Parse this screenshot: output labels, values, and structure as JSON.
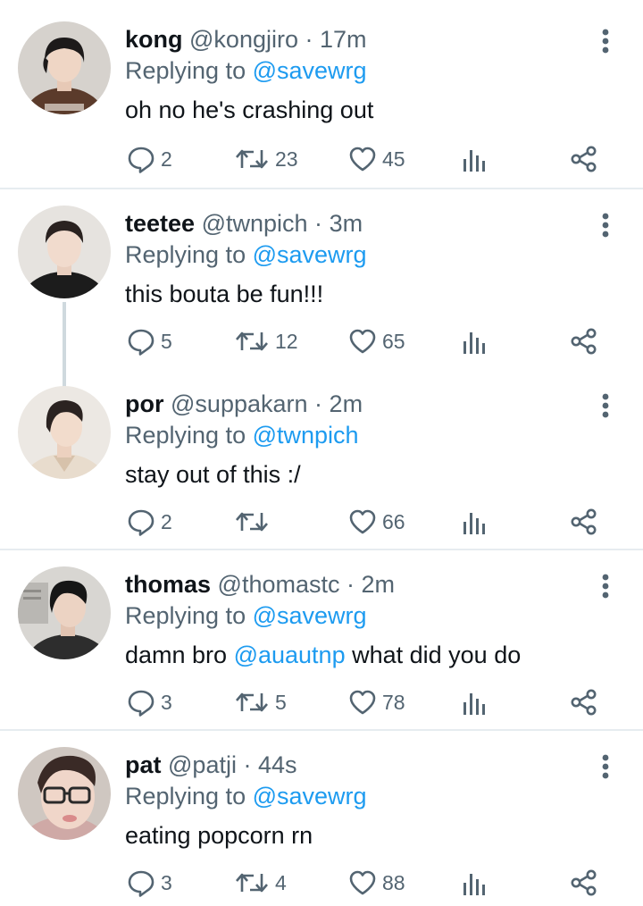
{
  "tweets": [
    {
      "name": "kong",
      "handle": "@kongjiro",
      "sep": "·",
      "time": "17m",
      "replying_prefix": "Replying to",
      "replying_to": "@savewrg",
      "text_before": "oh no he's crashing out",
      "mention": "",
      "text_after": "",
      "replies": "2",
      "retweets": "23",
      "likes": "45"
    },
    {
      "name": "teetee",
      "handle": "@twnpich",
      "sep": "·",
      "time": "3m",
      "replying_prefix": "Replying to",
      "replying_to": "@savewrg",
      "text_before": "this bouta be fun!!!",
      "mention": "",
      "text_after": "",
      "replies": "5",
      "retweets": "12",
      "likes": "65"
    },
    {
      "name": "por",
      "handle": "@suppakarn",
      "sep": "·",
      "time": "2m",
      "replying_prefix": "Replying to",
      "replying_to": "@twnpich",
      "text_before": "stay out of this :/",
      "mention": "",
      "text_after": "",
      "replies": "2",
      "retweets": "",
      "likes": "66"
    },
    {
      "name": "thomas",
      "handle": "@thomastc",
      "sep": "·",
      "time": "2m",
      "replying_prefix": "Replying to",
      "replying_to": "@savewrg",
      "text_before": "damn bro ",
      "mention": "@auautnp",
      "text_after": " what did you do",
      "replies": "3",
      "retweets": "5",
      "likes": "78"
    },
    {
      "name": "pat",
      "handle": "@patji",
      "sep": "·",
      "time": "44s",
      "replying_prefix": "Replying to",
      "replying_to": "@savewrg",
      "text_before": "eating popcorn rn",
      "mention": "",
      "text_after": "",
      "replies": "3",
      "retweets": "4",
      "likes": "88"
    }
  ],
  "icons": {
    "reply": "reply-icon",
    "retweet": "retweet-icon",
    "like": "heart-icon",
    "views": "views-icon",
    "share": "share-icon",
    "more": "more-vertical-icon"
  },
  "colors": {
    "link": "#1d9bf0",
    "secondary_text": "#536471",
    "divider": "#e6ecf0",
    "thread_line": "#cfd9de"
  }
}
